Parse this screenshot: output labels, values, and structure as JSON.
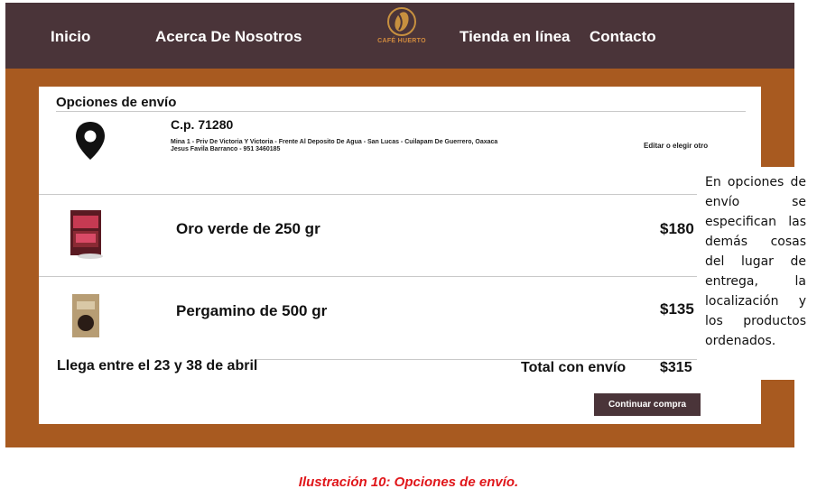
{
  "nav": {
    "items": [
      "Inicio",
      "Acerca De Nosotros",
      "Tienda en línea",
      "Contacto"
    ],
    "logo_text": "CAFÉ HUERTO"
  },
  "shipping": {
    "title": "Opciones de envío",
    "postal_code": "C.p. 71280",
    "address_line1": "Mina 1 - Priv De Victoria Y Victoria - Frente Al Deposito De Agua - San Lucas - Cuilapam De Guerrero, Oaxaca",
    "address_line2": "Jesus Favila Barranco - 951 3460185",
    "edit_label": "Editar o elegir otro"
  },
  "products": [
    {
      "name": "Oro verde de 250 gr",
      "price": "$180"
    },
    {
      "name": "Pergamino de 500 gr",
      "price": "$135"
    }
  ],
  "summary": {
    "eta": "Llega entre el 23 y 38 de abril",
    "total_label": "Total con envío",
    "total_value": "$315"
  },
  "continue_label": "Continuar compra",
  "note": "En opciones de envío se especifican las demás cosas del lugar de entrega, la localización y los productos ordenados.",
  "caption": "Ilustración 10: Opciones de envío.",
  "colors": {
    "navbar": "#4a3439",
    "frame": "#a85a20",
    "caption": "#e0161a"
  }
}
